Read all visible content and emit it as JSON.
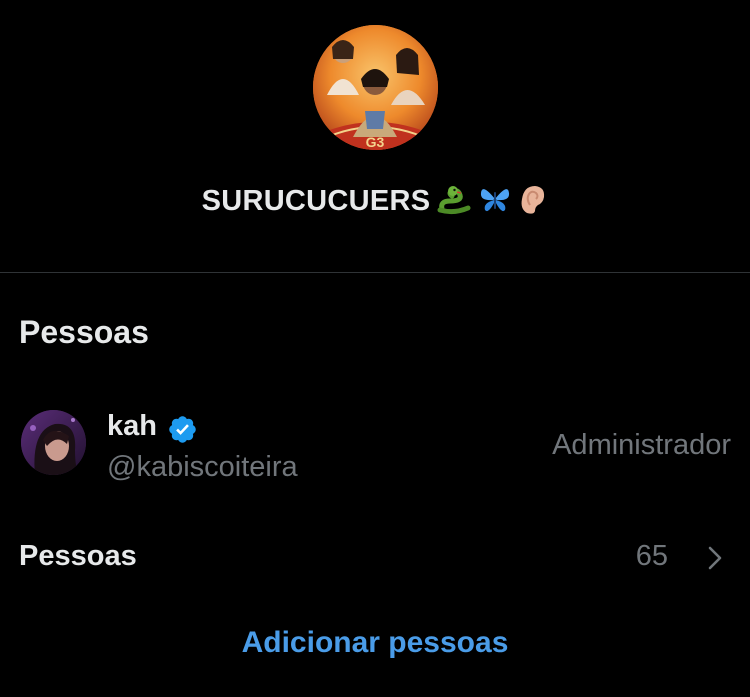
{
  "group": {
    "name": "SURUCUCUERS",
    "emojis": [
      "snake-emoji",
      "butterfly-emoji",
      "ear-emoji"
    ],
    "avatar_badge": "G3"
  },
  "people_section": {
    "title": "Pessoas",
    "members": [
      {
        "name": "kah",
        "handle": "@kabiscoiteira",
        "role": "Administrador",
        "verified": true
      }
    ]
  },
  "people_row": {
    "label": "Pessoas",
    "count": "65"
  },
  "actions": {
    "add_people_label": "Adicionar pessoas"
  },
  "colors": {
    "background": "#000000",
    "primary_text": "#e7e9ea",
    "secondary_text": "#71767b",
    "accent": "#4a9ce8",
    "verified": "#1d9bf0",
    "divider": "#2f3336"
  }
}
